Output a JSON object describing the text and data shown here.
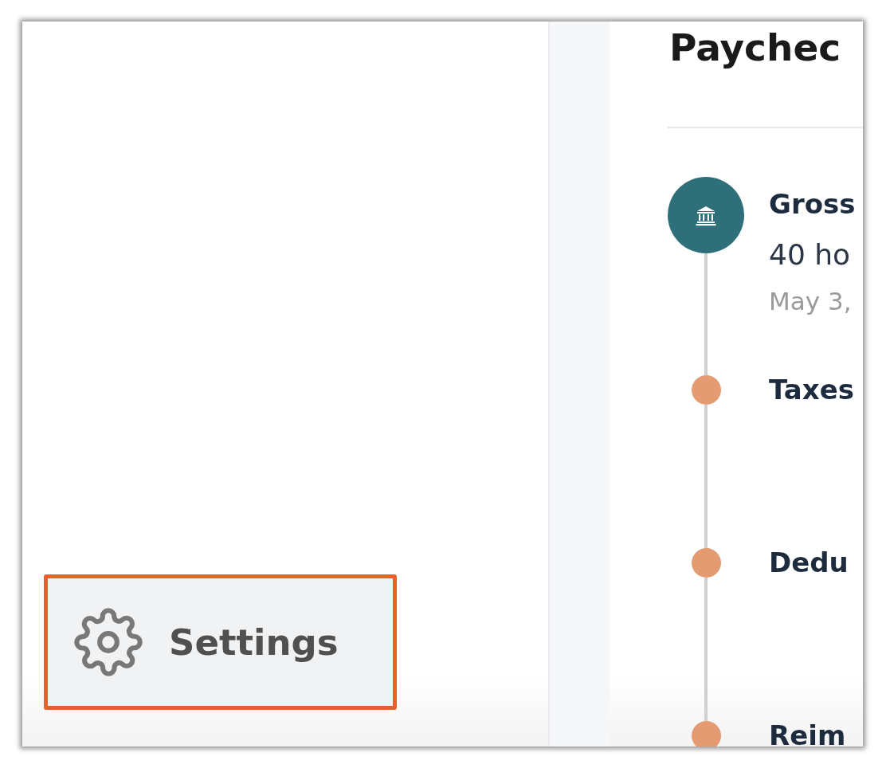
{
  "sidebar": {
    "settings_button": {
      "label": "Settings",
      "highlighted": true
    }
  },
  "page": {
    "title": "Paychec"
  },
  "timeline": [
    {
      "kind": "major",
      "color": "#2f6f7a",
      "title": "Gross",
      "detail": "40 ho",
      "date": "May 3,"
    },
    {
      "kind": "minor",
      "color": "#e59b72",
      "title": "Taxes"
    },
    {
      "kind": "minor",
      "color": "#e59b72",
      "title": "Dedu"
    },
    {
      "kind": "minor",
      "color": "#e59b72",
      "title": "Reim"
    }
  ]
}
